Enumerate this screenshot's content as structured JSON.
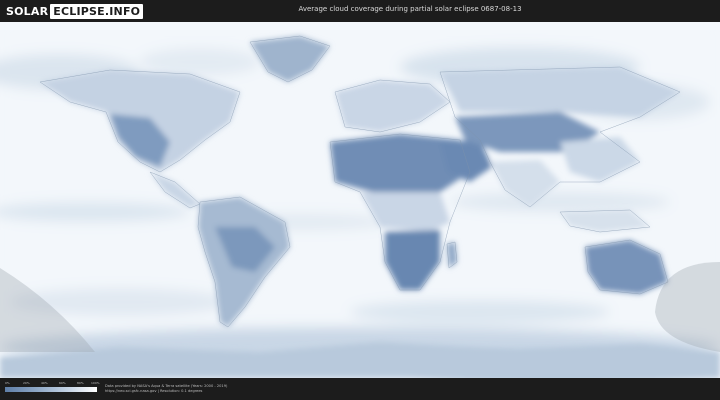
{
  "header": {
    "logo_part1": "SOLAR",
    "logo_part2": "ECLIPSE.INFO",
    "title": "Average cloud coverage during partial solar eclipse 0687-08-13"
  },
  "legend": {
    "ticks": [
      "0%",
      "20%",
      "40%",
      "60%",
      "80%",
      "100%"
    ],
    "colors": [
      "#5f7fa8",
      "#8ea7c6",
      "#c7d5e6",
      "#ffffff"
    ]
  },
  "credits": {
    "line1": "Data provided by NASA's Aqua & Terra satellite (Years: 2000 - 2019)",
    "line2": "https://neo.sci.gsfc.nasa.gov | Resolution: 0.1 degrees"
  },
  "map": {
    "ocean_color": "#f3f7fb",
    "cloud_light": "#dde6f0",
    "cloud_dark": "#5f7fa8",
    "eclipse_shade": "#c8ccd0"
  }
}
